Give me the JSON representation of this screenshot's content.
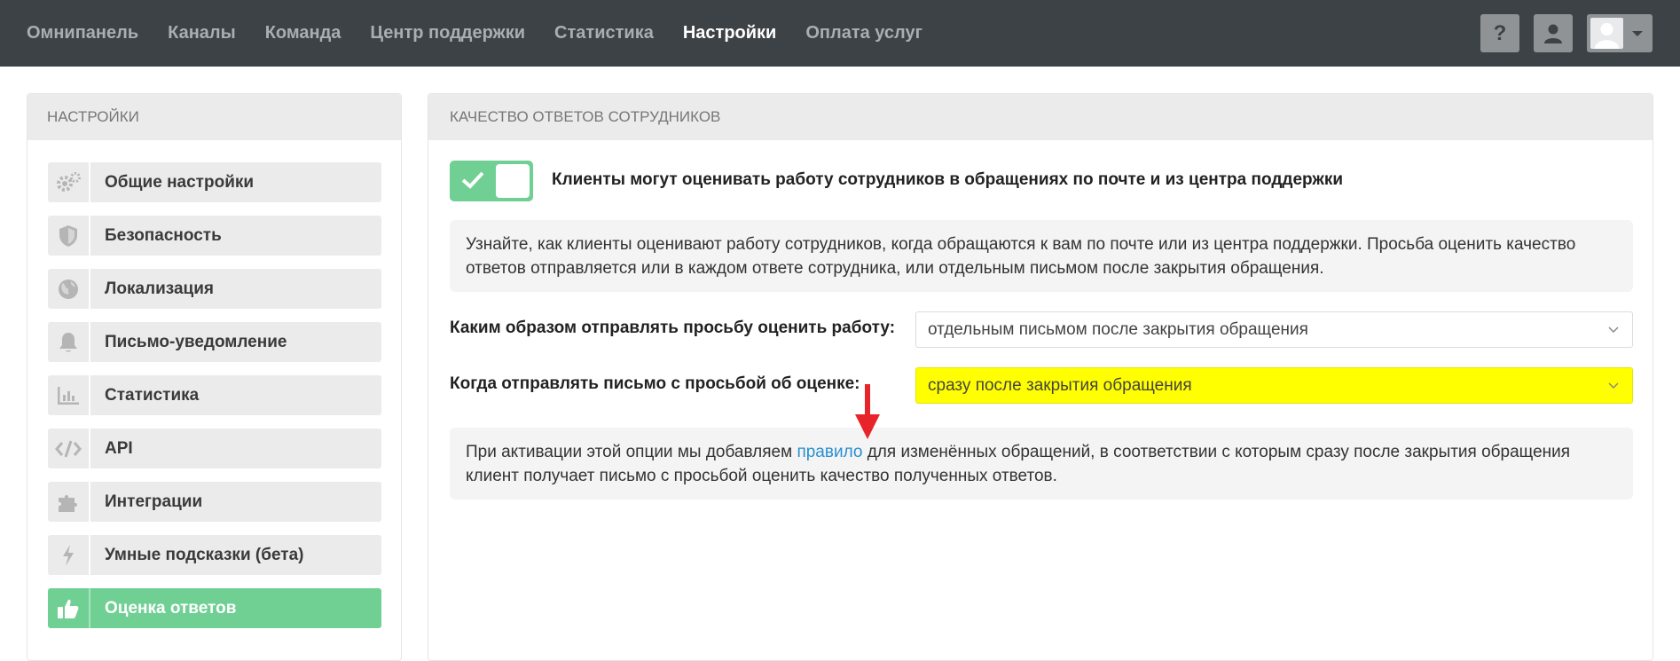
{
  "topnav": {
    "items": [
      {
        "label": "Омнипанель",
        "active": false
      },
      {
        "label": "Каналы",
        "active": false
      },
      {
        "label": "Команда",
        "active": false
      },
      {
        "label": "Центр поддержки",
        "active": false
      },
      {
        "label": "Статистика",
        "active": false
      },
      {
        "label": "Настройки",
        "active": true
      },
      {
        "label": "Оплата услуг",
        "active": false
      }
    ],
    "help_label": "?",
    "icons": [
      "help-icon",
      "user-icon",
      "avatar",
      "caret-down-icon"
    ]
  },
  "sidebar": {
    "title": "НАСТРОЙКИ",
    "items": [
      {
        "label": "Общие настройки",
        "icon": "gears-icon"
      },
      {
        "label": "Безопасность",
        "icon": "shield-icon"
      },
      {
        "label": "Локализация",
        "icon": "globe-icon"
      },
      {
        "label": "Письмо-уведомление",
        "icon": "bell-icon"
      },
      {
        "label": "Статистика",
        "icon": "bar-chart-icon"
      },
      {
        "label": "API",
        "icon": "code-icon"
      },
      {
        "label": "Интеграции",
        "icon": "puzzle-icon"
      },
      {
        "label": "Умные подсказки (бета)",
        "icon": "bolt-icon"
      },
      {
        "label": "Оценка ответов",
        "icon": "thumbs-up-icon",
        "active": true
      }
    ]
  },
  "main": {
    "title": "КАЧЕСТВО ОТВЕТОВ СОТРУДНИКОВ",
    "toggle": {
      "on": true,
      "label": "Клиенты могут оценивать работу сотрудников в обращениях по почте и из центра поддержки"
    },
    "info1": "Узнайте, как клиенты оценивают работу сотрудников, когда обращаются к вам по почте или из центра поддержки. Просьба оценить качество ответов отправляется или в каждом ответе сотрудника, или отдельным письмом после закрытия обращения.",
    "method": {
      "label": "Каким образом отправлять просьбу оценить работу:",
      "value": "отдельным письмом после закрытия обращения"
    },
    "timing": {
      "label": "Когда отправлять письмо с просьбой об оценке:",
      "value": "сразу после закрытия обращения"
    },
    "info2": {
      "before": "При активации этой опции мы добавляем ",
      "link": "правило",
      "after": " для изменённых обращений, в соответствии с которым сразу после закрытия обращения клиент получает письмо с просьбой оценить качество полученных ответов."
    }
  },
  "colors": {
    "topbar": "#3d4246",
    "accent_green": "#70d094",
    "highlight_yellow": "#ffff00",
    "link_blue": "#2a8fd0",
    "annotation_red": "#e8242b"
  }
}
